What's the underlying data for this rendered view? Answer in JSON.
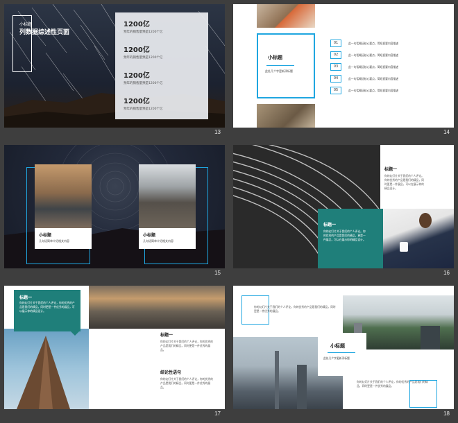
{
  "s13": {
    "number": "13",
    "title": "小标题",
    "subtitle": "列数据综述性页面",
    "stats": [
      {
        "value": "1200亿",
        "desc": "预年的销售量预是1200个亿"
      },
      {
        "value": "1200亿",
        "desc": "预年的销售量预是1200个亿"
      },
      {
        "value": "1200亿",
        "desc": "预年的销售量预是1200个亿"
      },
      {
        "value": "1200亿",
        "desc": "预年的销售量预是1200个亿"
      }
    ]
  },
  "s14": {
    "number": "14",
    "box_title": "小标题",
    "box_text": "此处几个字更新添标题",
    "items": [
      {
        "num": "01",
        "text": "此一句话概括核心要点，简短扼要内容描述"
      },
      {
        "num": "02",
        "text": "此一句话概括核心要点，简短扼要内容描述"
      },
      {
        "num": "03",
        "text": "此一句话概括核心要点，简短扼要内容描述"
      },
      {
        "num": "04",
        "text": "此一句话概括核心要点，简短扼要内容描述"
      },
      {
        "num": "05",
        "text": "此一句话概括核心要点，简短扼要内容描述"
      }
    ]
  },
  "s15": {
    "number": "15",
    "cards": [
      {
        "title": "小标题",
        "text": "几句话简单介绍相关内容"
      },
      {
        "title": "小标题",
        "text": "几句话简单介绍相关内容"
      }
    ]
  },
  "s16": {
    "number": "16",
    "top_title": "标题一",
    "top_text": "你的幻灯片关于我们的个人评论。你的优秀的产品是我们的精品，同时更是一件展品，可以在展示你的精品设计。",
    "teal_title": "标题一",
    "teal_text": "你的幻灯片关于我们的个人评论。你的优秀的产品是我们的精品，更是一件展品，可以在展示你的精品设计。"
  },
  "s17": {
    "number": "17",
    "teal_title": "标题一",
    "teal_text": "你的幻灯片关于我们的个人评论，你的优秀的产品是我们的精品，同时更是一件优秀的展品，可以展示你的精品设计。",
    "mid_title": "标题一",
    "mid_text": "你的幻灯片关于我们的个人评论，你的优秀的产品是我们的精品，同时更是一件优秀的展品。",
    "conc_title": "结论性语句",
    "conc_text": "你的幻灯片关于我们的个人评论，你的优秀的产品是我们的精品，同时更是一件优秀的展品。"
  },
  "s18": {
    "number": "18",
    "top_text": "你的幻灯片关于我们的个人评论，你的优秀的产品是我们的精品，同时更是一件优秀的展品。",
    "center_title": "小标题",
    "center_text": "此处几个字更新添标题",
    "bottom_text": "你的幻灯片关于我们的个人评论，你的优秀的产品是我们的精品，同时更是一件优秀的展品。"
  },
  "colors": {
    "accent_blue": "#1fa6e0",
    "teal": "#1f7f7a",
    "night": "#1d2430"
  }
}
